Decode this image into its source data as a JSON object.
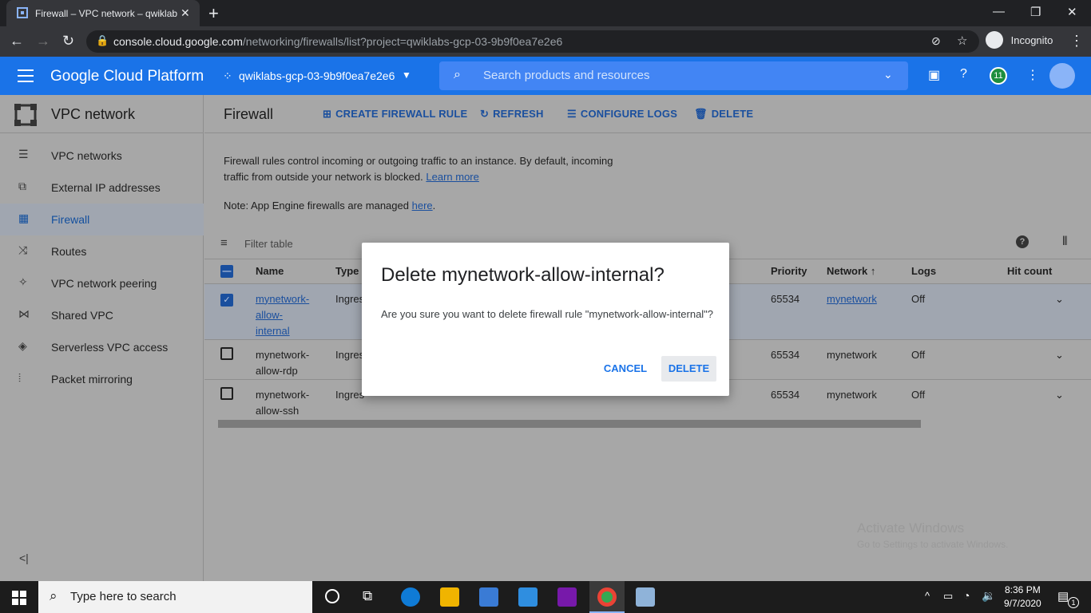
{
  "browser": {
    "tab_title": "Firewall – VPC network – qwiklab",
    "url_host": "console.cloud.google.com",
    "url_path": "/networking/firewalls/list?project=qwiklabs-gcp-03-9b9f0ea7e2e6",
    "incognito_label": "Incognito"
  },
  "gcp_header": {
    "brand": "Google Cloud Platform",
    "project": "qwiklabs-gcp-03-9b9f0ea7e2e6",
    "search_placeholder": "Search products and resources",
    "notification_count": "11"
  },
  "sidebar": {
    "title": "VPC network",
    "items": [
      {
        "label": "VPC networks",
        "icon": "vpc-networks-icon"
      },
      {
        "label": "External IP addresses",
        "icon": "external-ip-icon"
      },
      {
        "label": "Firewall",
        "icon": "firewall-icon"
      },
      {
        "label": "Routes",
        "icon": "routes-icon"
      },
      {
        "label": "VPC network peering",
        "icon": "peering-icon"
      },
      {
        "label": "Shared VPC",
        "icon": "shared-vpc-icon"
      },
      {
        "label": "Serverless VPC access",
        "icon": "serverless-icon"
      },
      {
        "label": "Packet mirroring",
        "icon": "packet-mirroring-icon"
      }
    ]
  },
  "toolbar": {
    "page_title": "Firewall",
    "create": "CREATE FIREWALL RULE",
    "refresh": "REFRESH",
    "configure_logs": "CONFIGURE LOGS",
    "delete": "DELETE"
  },
  "description": {
    "line1": "Firewall rules control incoming or outgoing traffic to an instance. By default, incoming",
    "line2": "traffic from outside your network is blocked.",
    "learn_more": "Learn more",
    "note": "Note: App Engine firewalls are managed",
    "here": "here",
    "period": "."
  },
  "table": {
    "filter_placeholder": "Filter table",
    "headers": {
      "name": "Name",
      "type": "Type",
      "priority": "Priority",
      "network": "Network",
      "logs": "Logs",
      "hit_count": "Hit count"
    },
    "rows": [
      {
        "name1": "mynetwork-",
        "name2": "allow-",
        "name3": "internal",
        "type": "Ingres",
        "priority": "65534",
        "network": "mynetwork",
        "logs": "Off"
      },
      {
        "name1": "mynetwork-",
        "name2": "allow-rdp",
        "type": "Ingres",
        "priority": "65534",
        "network": "mynetwork",
        "logs": "Off"
      },
      {
        "name1": "mynetwork-",
        "name2": "allow-ssh",
        "type": "Ingres",
        "priority": "65534",
        "network": "mynetwork",
        "logs": "Off"
      }
    ]
  },
  "dialog": {
    "title": "Delete mynetwork-allow-internal?",
    "message": "Are you sure you want to delete firewall rule \"mynetwork-allow-internal\"?",
    "cancel": "CANCEL",
    "confirm": "DELETE"
  },
  "watermark": {
    "title": "Activate Windows",
    "subtitle": "Go to Settings to activate Windows."
  },
  "taskbar": {
    "search_placeholder": "Type here to search",
    "time": "8:36 PM",
    "date": "9/7/2020",
    "notifications": "1"
  },
  "colors": {
    "gcp_blue": "#1a73e8",
    "link_blue": "#1a4f9e",
    "dim_overlay": "#a7a7a7"
  }
}
